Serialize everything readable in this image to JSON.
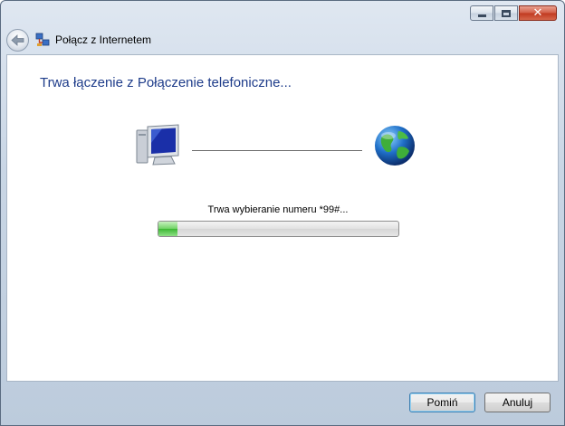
{
  "window": {
    "title": "Połącz z Internetem"
  },
  "caption": {
    "minimize_icon": "minimize-icon",
    "maximize_icon": "maximize-icon",
    "close_icon": "close-icon",
    "close_glyph": "✕"
  },
  "main": {
    "heading": "Trwa łączenie z Połączenie telefoniczne...",
    "status": "Trwa wybieranie numeru *99#...",
    "progress_fraction": 0.08
  },
  "footer": {
    "skip_label": "Pomiń",
    "cancel_label": "Anuluj"
  },
  "colors": {
    "heading": "#1e3c8a",
    "progress_green": "#3cb733"
  }
}
